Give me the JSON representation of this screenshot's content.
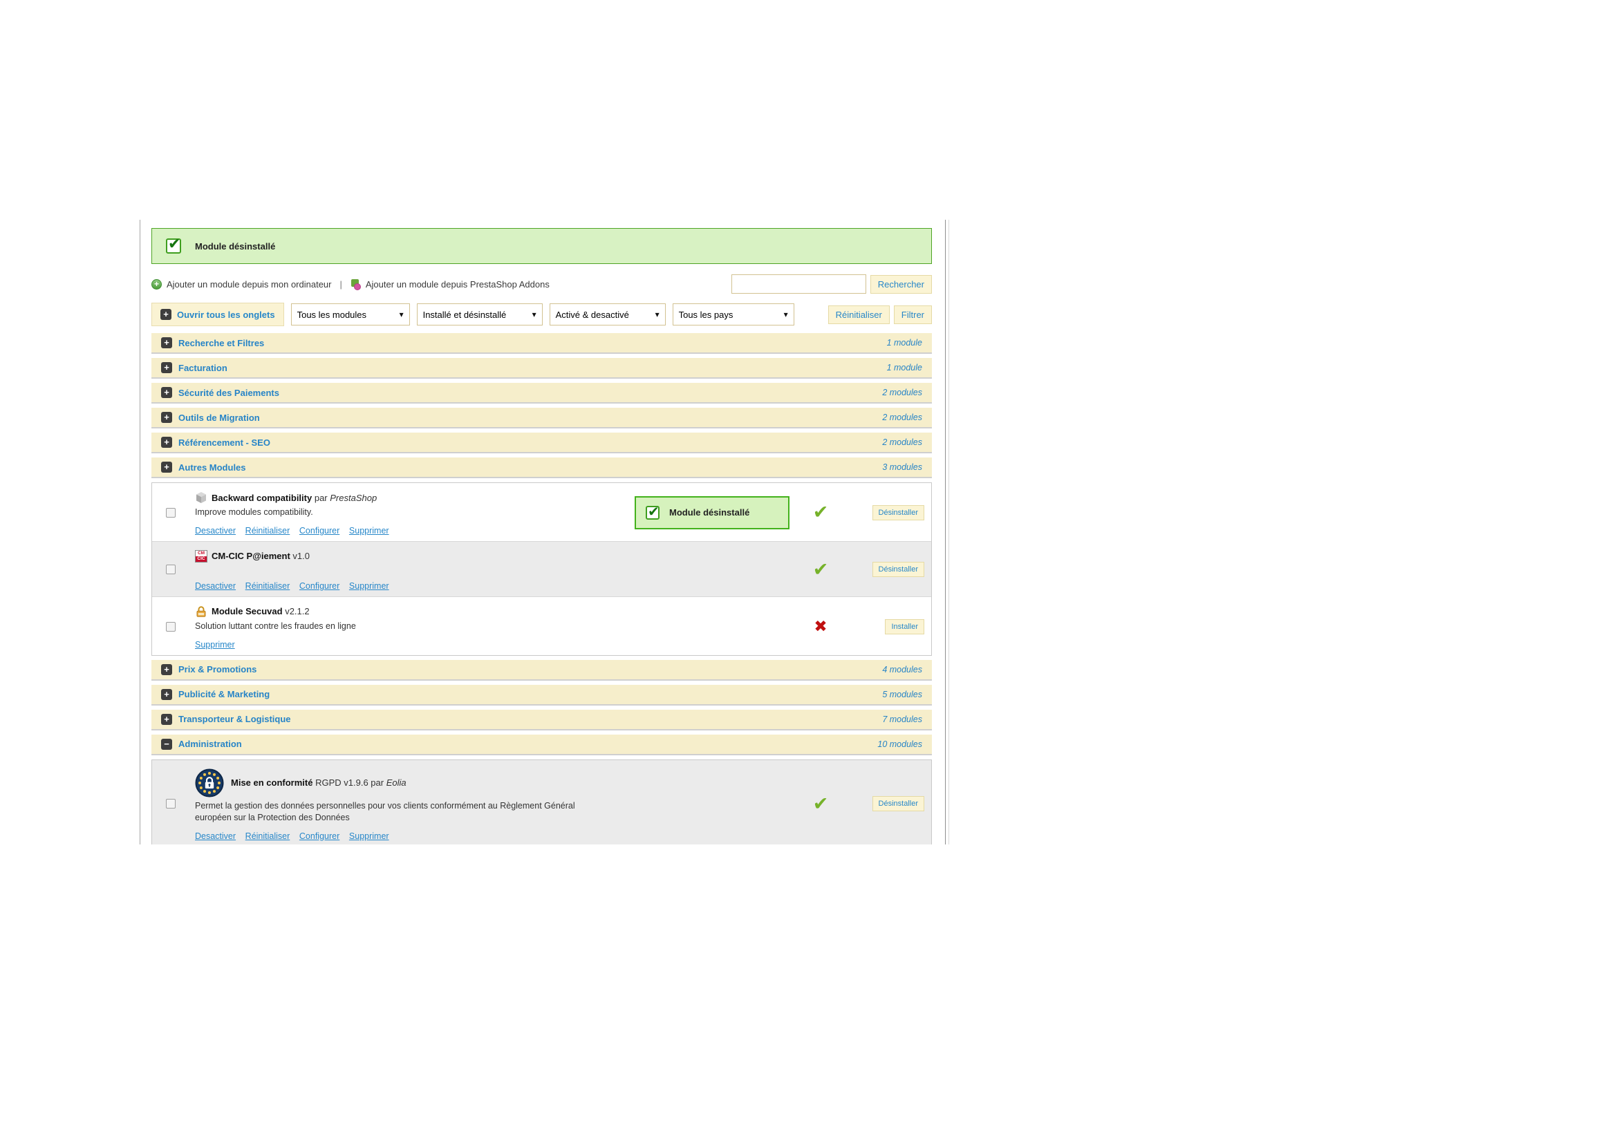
{
  "alert": {
    "message": "Module désinstallé"
  },
  "add_row": {
    "add_from_computer": "Ajouter un module depuis mon ordinateur",
    "separator": "|",
    "add_from_addons": "Ajouter un module depuis PrestaShop Addons",
    "search_value": "",
    "search_button": "Rechercher"
  },
  "toolbar": {
    "open_all_tabs": "Ouvrir tous les onglets",
    "selects": [
      {
        "value": "Tous les modules"
      },
      {
        "value": "Installé et désinstallé"
      },
      {
        "value": "Activé & desactivé"
      },
      {
        "value": "Tous les pays"
      }
    ],
    "reset_button": "Réinitialiser",
    "filter_button": "Filtrer"
  },
  "categories": [
    {
      "label": "Recherche et Filtres",
      "count": "1 module",
      "expanded": false
    },
    {
      "label": "Facturation",
      "count": "1 module",
      "expanded": false
    },
    {
      "label": "Sécurité des Paiements",
      "count": "2 modules",
      "expanded": false
    },
    {
      "label": "Outils de Migration",
      "count": "2 modules",
      "expanded": false
    },
    {
      "label": "Référencement - SEO",
      "count": "2 modules",
      "expanded": false
    },
    {
      "label": "Autres Modules",
      "count": "3 modules",
      "expanded": false
    },
    {
      "label": "Prix & Promotions",
      "count": "4 modules",
      "expanded": false
    },
    {
      "label": "Publicité & Marketing",
      "count": "5 modules",
      "expanded": false
    },
    {
      "label": "Transporteur & Logistique",
      "count": "7 modules",
      "expanded": false
    },
    {
      "label": "Administration",
      "count": "10 modules",
      "expanded": true
    }
  ],
  "modules": [
    {
      "name": "Backward compatibility",
      "meta": "par",
      "author": "PrestaShop",
      "description": "Improve modules compatibility.",
      "links": [
        "Desactiver",
        "Réinitialiser",
        "Configurer",
        "Supprimer"
      ],
      "inline_alert": "Module désinstallé",
      "status": "installed",
      "action_button": "Désinstaller"
    },
    {
      "name": "CM-CIC P@iement",
      "meta": "v1.0",
      "links": [
        "Desactiver",
        "Réinitialiser",
        "Configurer",
        "Supprimer"
      ],
      "status": "installed",
      "action_button": "Désinstaller"
    },
    {
      "name": "Module Secuvad",
      "meta": "v2.1.2",
      "description": "Solution luttant contre les fraudes en ligne",
      "links": [
        "Supprimer"
      ],
      "status": "not-installed",
      "action_button": "Installer"
    },
    {
      "name": "Mise en conformité",
      "meta": "RGPD v1.9.6 par",
      "author": "Eolia",
      "description": "Permet la gestion des données personnelles pour vos clients conformément au Règlement Général européen sur la Protection des Données",
      "links": [
        "Desactiver",
        "Réinitialiser",
        "Configurer",
        "Supprimer"
      ],
      "status": "installed",
      "action_button": "Désinstaller"
    }
  ],
  "colors": {
    "accent_blue": "#2787c9",
    "category_bg": "#f6eecb",
    "button_bg": "#fbf4d4",
    "alert_green_bg": "#d8f2c3",
    "alert_green_border": "#4ea424",
    "check_green": "#76b22a",
    "cross_red": "#c01010"
  }
}
